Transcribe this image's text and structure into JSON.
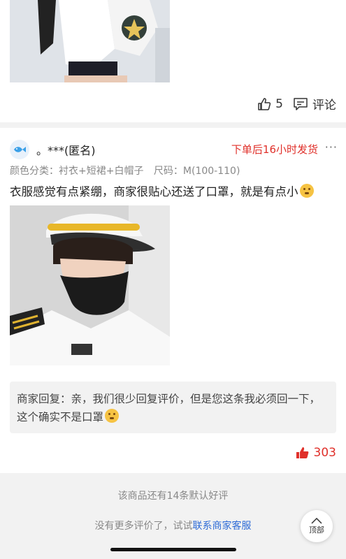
{
  "review_prev": {
    "like_count": "5",
    "comment_label": "评论"
  },
  "review_main": {
    "username": "。***(匿名)",
    "ship_time": "下单后16小时发货",
    "more": "···",
    "spec_color": "颜色分类：衬衣+短裙+白帽子",
    "spec_size": "尺码：M(100-110)",
    "text": "衣服感觉有点紧绷，商家很贴心还送了口罩，就是有点小",
    "merchant_reply": "商家回复：亲，我们很少回复评价，但是您这条我必须回一下，这个确实不是口罩",
    "like_count": "303"
  },
  "footer": {
    "default_reviews": "该商品还有14条默认好评",
    "no_more_prefix": "没有更多评价了，试试",
    "contact_link": "联系商家客服",
    "top_button": "顶部"
  },
  "colors": {
    "accent_red": "#e0302a",
    "link_blue": "#2e6bd6"
  },
  "icons": [
    "thumbs-up-icon",
    "comment-icon",
    "avatar-fish-icon",
    "more-icon",
    "emoji-icon",
    "arrow-up-icon"
  ]
}
